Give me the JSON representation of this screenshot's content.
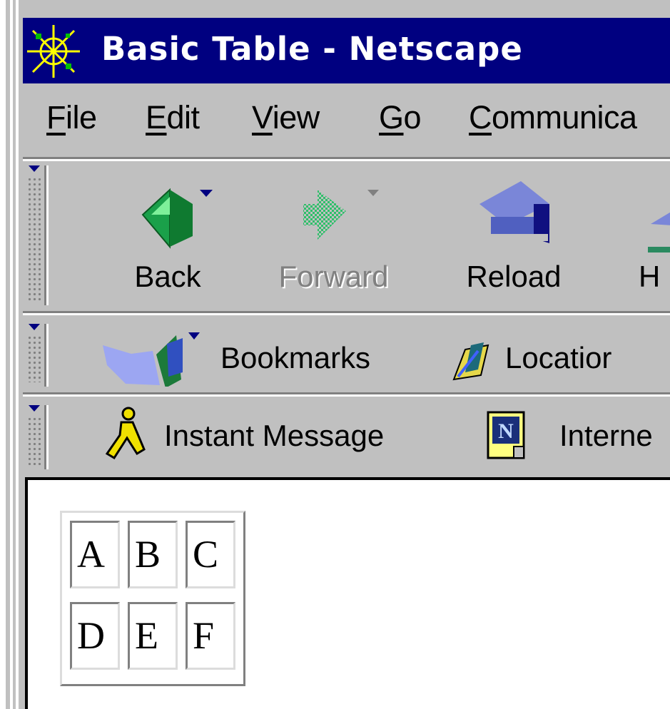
{
  "window": {
    "title": "Basic Table - Netscape"
  },
  "menu": [
    {
      "label": "File",
      "mnemonic": "F",
      "rest": "ile"
    },
    {
      "label": "Edit",
      "mnemonic": "E",
      "rest": "dit"
    },
    {
      "label": "View",
      "mnemonic": "V",
      "rest": "iew"
    },
    {
      "label": "Go",
      "mnemonic": "G",
      "rest": "o"
    },
    {
      "label": "Communicator",
      "mnemonic": "C",
      "rest": "ommunica"
    }
  ],
  "navigation_toolbar": {
    "buttons": [
      {
        "label": "Back",
        "icon": "back-arrow-icon",
        "enabled": true
      },
      {
        "label": "Forward",
        "icon": "forward-arrow-icon",
        "enabled": false
      },
      {
        "label": "Reload",
        "icon": "reload-icon",
        "enabled": true
      },
      {
        "label": "H",
        "icon": "home-icon",
        "enabled": true
      }
    ]
  },
  "location_toolbar": {
    "bookmarks_label": "Bookmarks",
    "location_label": "Locatior"
  },
  "personal_toolbar": {
    "instant_message_label": "Instant Message",
    "internet_label": "Interne"
  },
  "page": {
    "table": {
      "rows": [
        [
          "A",
          "B",
          "C"
        ],
        [
          "D",
          "E",
          "F"
        ]
      ]
    }
  },
  "colors": {
    "titlebar": "#000080",
    "chrome": "#c0c0c0",
    "content_bg": "#ffffff"
  }
}
